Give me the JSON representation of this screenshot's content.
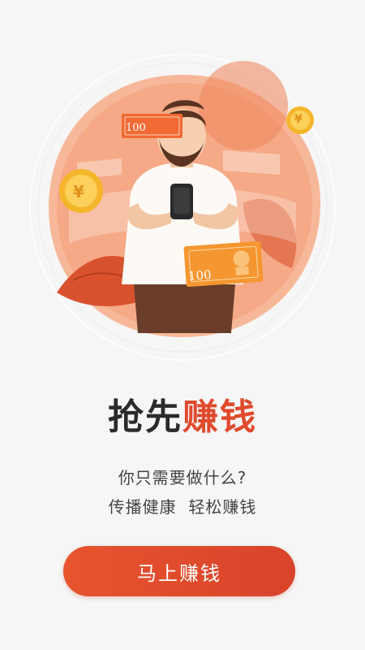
{
  "hero": {
    "illustration": "person-with-phone-and-money",
    "banknote_left_value": "100",
    "banknote_right_value": "100",
    "coin_icon": "yuan-coin-icon",
    "colors": {
      "accent": "#e04a2d",
      "peach": "#f5a07a",
      "light_peach": "#fbd6c3"
    }
  },
  "title": {
    "part1": "抢先",
    "part2": "赚钱"
  },
  "subtitle": {
    "line1": "你只需要做什么?",
    "line2": "传播健康  轻松赚钱"
  },
  "cta": {
    "label": "马上赚钱"
  }
}
